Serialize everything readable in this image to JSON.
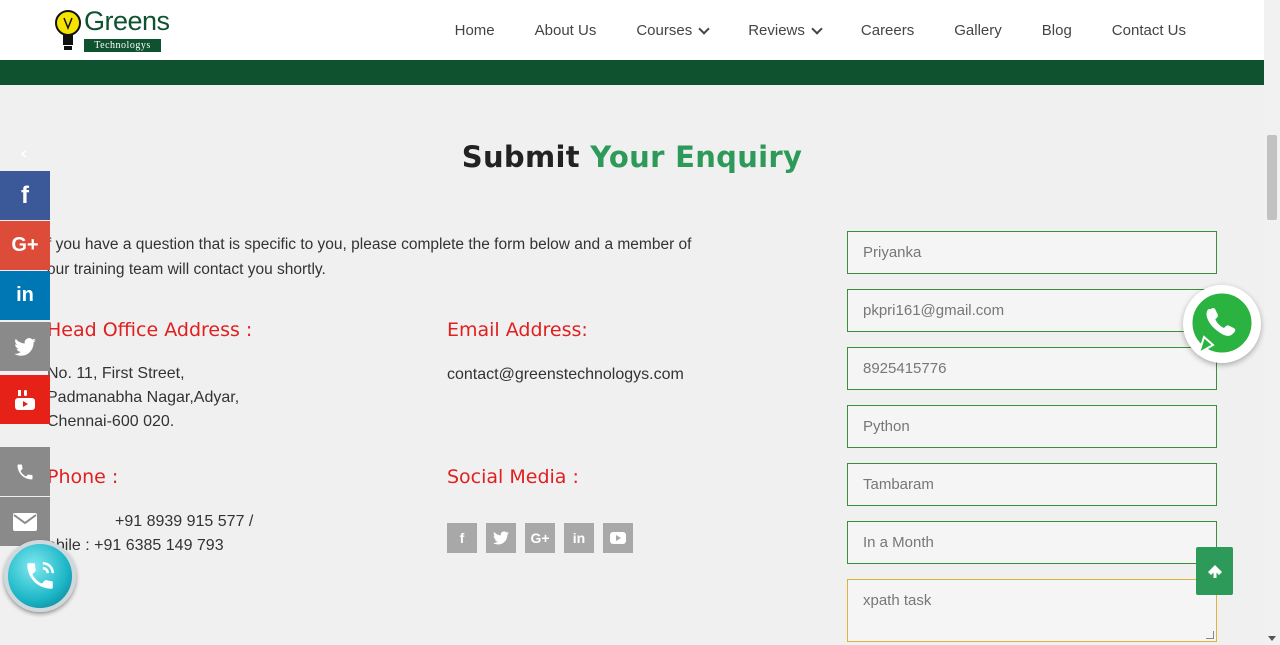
{
  "header": {
    "logo_text": "Greens",
    "logo_sub": "Technologys",
    "nav": [
      {
        "label": "Home"
      },
      {
        "label": "About Us"
      },
      {
        "label": "Courses"
      },
      {
        "label": "Reviews"
      },
      {
        "label": "Careers"
      },
      {
        "label": "Gallery"
      },
      {
        "label": "Blog"
      },
      {
        "label": "Contact Us"
      }
    ]
  },
  "section": {
    "title_part1": "Submit ",
    "title_part2": "Your Enquiry",
    "intro_line1": "f you have a question that is specific to you, please complete the form below and a member of",
    "intro_line2": "our training team will contact you shortly."
  },
  "address": {
    "label": "Head Office Address :",
    "line1": "No. 11, First Street,",
    "line2": "Padmanabha Nagar,Adyar,",
    "line3": "Chennai-600 020."
  },
  "email": {
    "label": "Email Address:",
    "value": "contact@greenstechnologys.com"
  },
  "phone": {
    "label": "Phone :",
    "line1": "+91 8939 915 577 /",
    "line2": "obile : +91 6385 149 793"
  },
  "social": {
    "label": "Social Media :",
    "icons": [
      "f",
      "t",
      "G+",
      "in",
      "yt"
    ]
  },
  "form": {
    "name": "Priyanka",
    "email": "pkpri161@gmail.com",
    "phone": "8925415776",
    "course": "Python",
    "location": "Tambaram",
    "timeframe": "In a Month",
    "message": "xpath task"
  },
  "sidebar": {
    "facebook_color": "#3b5998",
    "google_color": "#dd4b39",
    "linkedin_color": "#0077b5",
    "twitter_color": "#8a8a8a",
    "youtube_color": "#e62117",
    "phone_color": "#8a8a8a",
    "mail_color": "#8a8a8a"
  },
  "colors": {
    "brand_green": "#0f5230",
    "accent_green": "#2e9a5a",
    "label_red": "#e02020"
  }
}
